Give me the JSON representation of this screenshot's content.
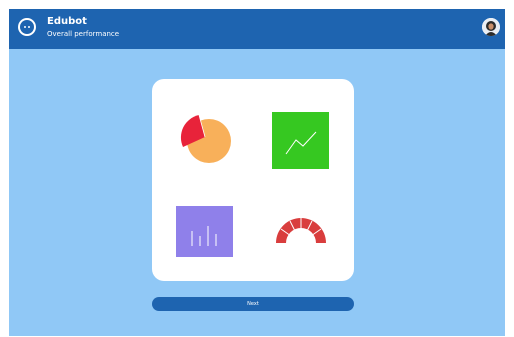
{
  "header": {
    "title": "Edubot",
    "subtitle": "Overall performance"
  },
  "icons": {
    "logo": "edubot-logo-icon",
    "avatar": "user-avatar",
    "pie": "pie-chart-icon",
    "line": "line-chart-icon",
    "bar": "bar-chart-icon",
    "gauge": "gauge-icon"
  },
  "colors": {
    "header": "#1e64b0",
    "background": "#90c8f6",
    "pie_main": "#f8b05a",
    "pie_slice": "#e8233a",
    "line_tile": "#36c821",
    "bar_tile": "#8f80ea",
    "gauge": "#d93d3d"
  },
  "actions": {
    "next_label": "Next"
  }
}
